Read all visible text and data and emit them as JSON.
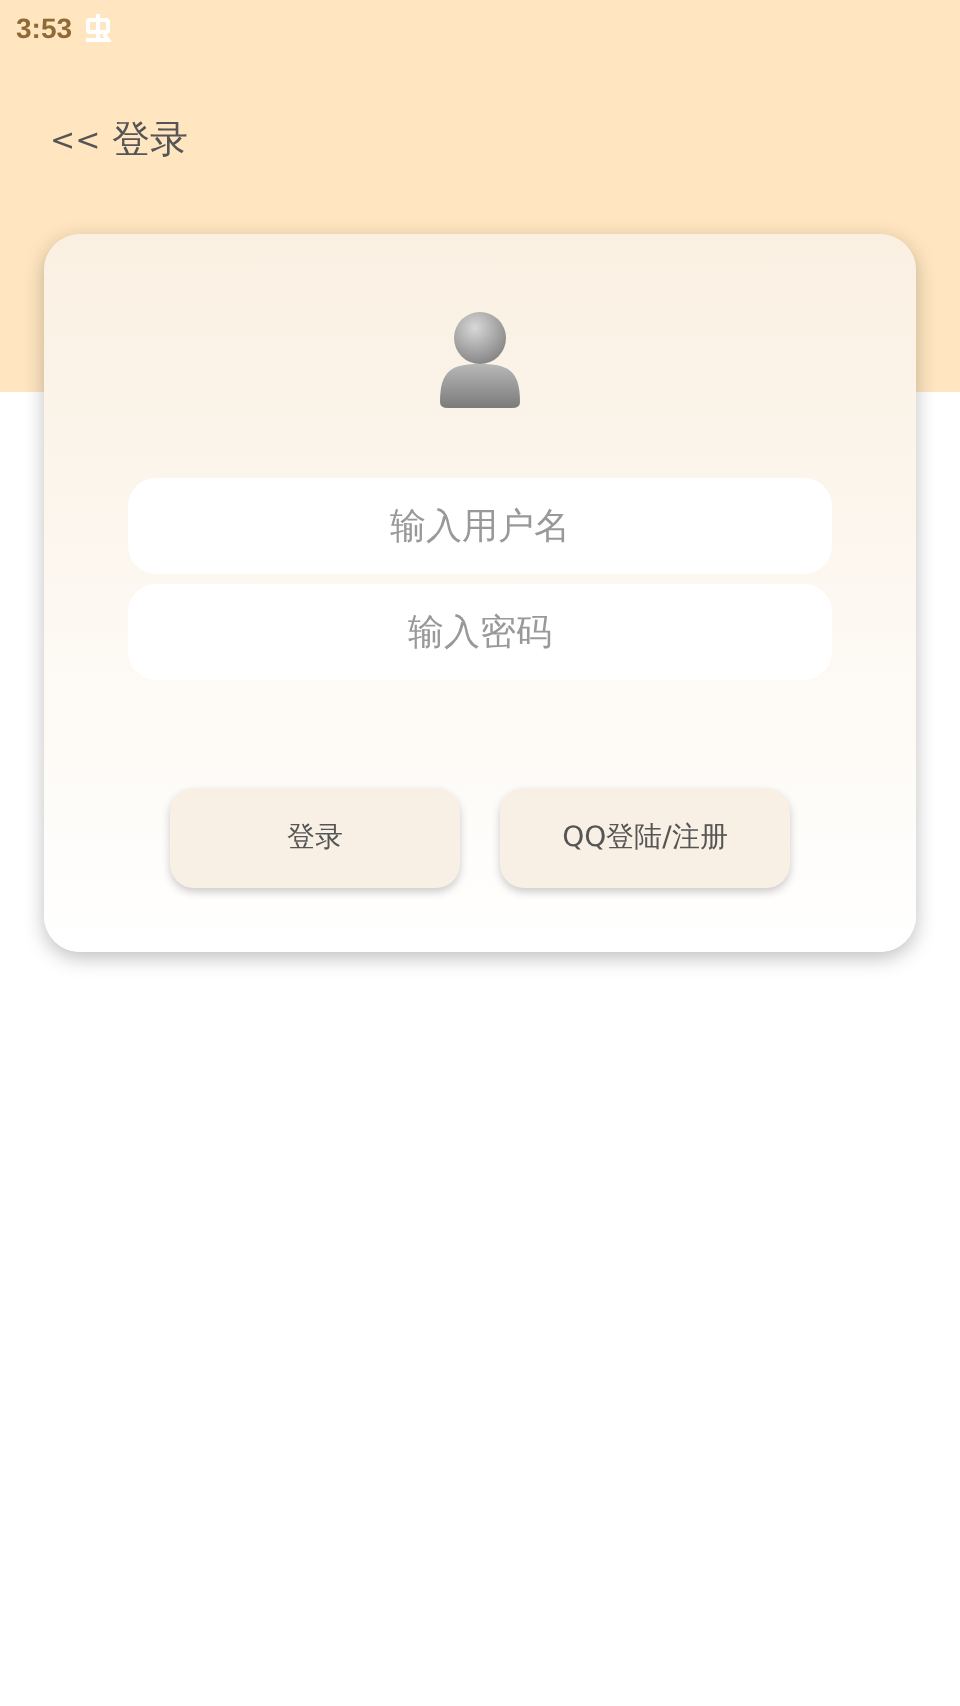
{
  "status_bar": {
    "time": "3:53"
  },
  "header": {
    "back": "<<",
    "title": "登录"
  },
  "form": {
    "username": {
      "placeholder": "输入用户名"
    },
    "password": {
      "placeholder": "输入密码"
    },
    "buttons": [
      "登录",
      "QQ登陆/注册"
    ]
  }
}
